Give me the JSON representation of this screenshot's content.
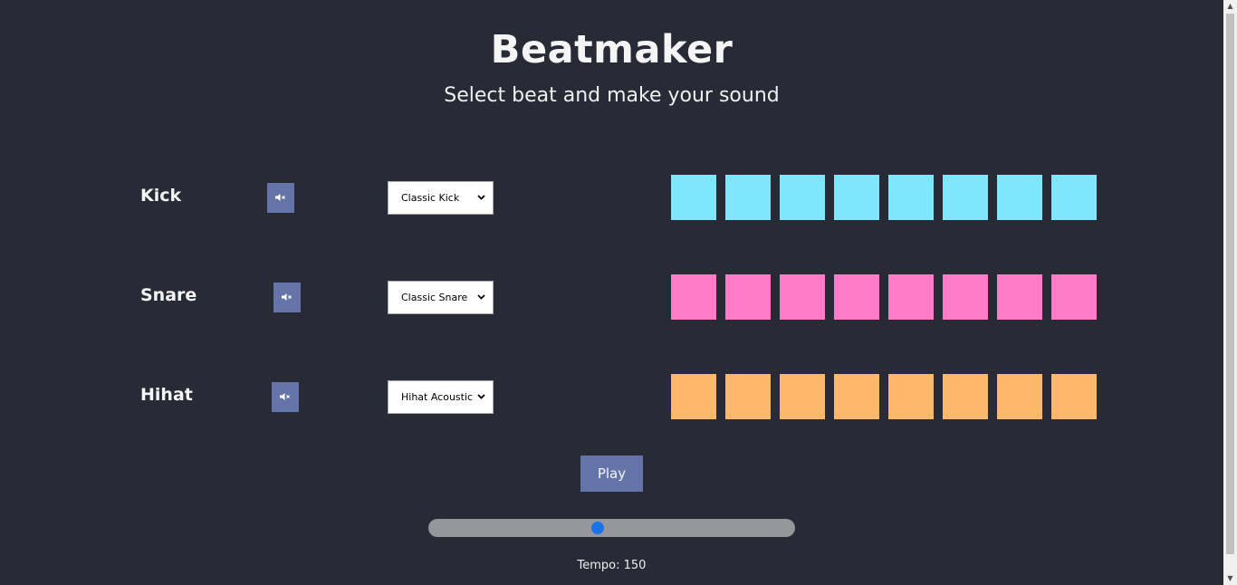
{
  "header": {
    "title": "Beatmaker",
    "subtitle": "Select beat and make your sound"
  },
  "tracks": [
    {
      "name": "Kick",
      "selected_sound": "Classic Kick",
      "pad_color": "#7fe6fd",
      "pad_count": 8
    },
    {
      "name": "Snare",
      "selected_sound": "Classic Snare",
      "pad_color": "#ff7bc8",
      "pad_count": 8
    },
    {
      "name": "Hihat",
      "selected_sound": "Hihat Acoustic",
      "pad_color": "#ffb76b",
      "pad_count": 8
    }
  ],
  "controls": {
    "play_label": "Play",
    "tempo_label": "Tempo: 150",
    "tempo_fraction": 0.46
  },
  "icons": {
    "mute": "mute-speaker-icon",
    "select_arrow": "chevron-down-icon"
  },
  "colors": {
    "background": "#282a35",
    "button": "#6474a8",
    "slider_thumb": "#1a73e8"
  }
}
